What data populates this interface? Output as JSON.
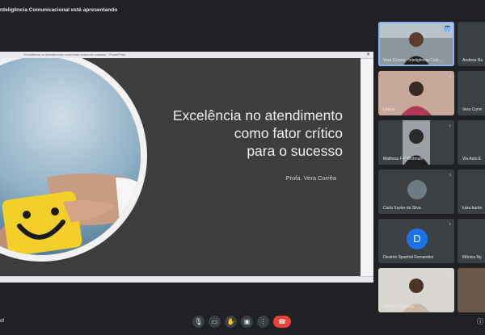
{
  "presenting_banner": "nteligência Comunicacional está apresentando",
  "presentation": {
    "window_title": "Excelência no Atendimento como fator crítico de sucesso - PowerPoint",
    "slide_title_lines": [
      "Excelência no atendimento",
      "como fator crítico",
      "para o sucesso"
    ],
    "slide_author": "Profa. Vera Corrêa"
  },
  "participants": [
    {
      "name": "Vera Correa - Inteligência Com...",
      "active": true,
      "more": "•••"
    },
    {
      "name": "Andreia Ra",
      "partial": true
    },
    {
      "name": "Leticia",
      "mic": "♪"
    },
    {
      "name": "Vera Corre",
      "partial": true
    },
    {
      "name": "Matheus F P Wotmuth",
      "mic": "♪"
    },
    {
      "name": "Via Auto E",
      "partial": true
    },
    {
      "name": "Carla Xavier da Silva",
      "mic": "♪"
    },
    {
      "name": "luiza barbo",
      "partial": true
    },
    {
      "name": "Desirée Spanhol Fernandes",
      "avatar_letter": "D",
      "mic": "♪"
    },
    {
      "name": "Mônica Ny",
      "partial": true
    },
    {
      "name": "Crisley Dalbosco",
      "mic": "♪"
    },
    {
      "name": "",
      "partial": true
    }
  ],
  "controls": {
    "left_label": "of",
    "mic_icon": "🎙",
    "camera_icon": "▭",
    "hand_icon": "✋",
    "present_icon": "▣",
    "more_icon": "⋮",
    "end_call_icon": "☎",
    "info_icon": "ⓘ"
  },
  "colors": {
    "background": "#202124",
    "end_call": "#ea4335",
    "avatar": "#1a73e8",
    "active_outline": "#8ab4f8"
  }
}
